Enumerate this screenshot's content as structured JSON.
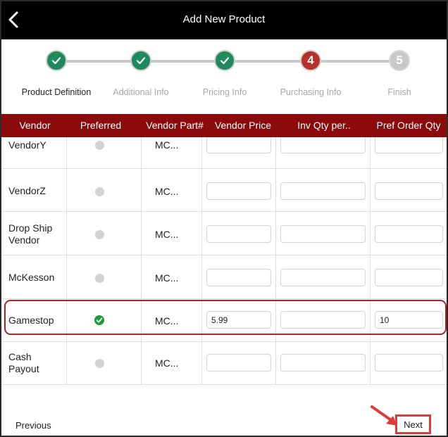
{
  "header": {
    "title": "Add New Product",
    "back_icon": "chevron-left-icon"
  },
  "stepper": {
    "steps": [
      {
        "label": "Product Definition",
        "state": "done",
        "marker": ""
      },
      {
        "label": "Additional Info",
        "state": "done",
        "marker": ""
      },
      {
        "label": "Pricing Info",
        "state": "done",
        "marker": ""
      },
      {
        "label": "Purchasing Info",
        "state": "active",
        "marker": "4"
      },
      {
        "label": "Finish",
        "state": "pending",
        "marker": "5"
      }
    ],
    "colors": {
      "done": "#1f8a5e",
      "active": "#b5312a",
      "pending": "#c8c8c8"
    }
  },
  "table": {
    "header_color": "#8b0a0c",
    "columns": [
      "Vendor",
      "Preferred",
      "Vendor Part#",
      "Vendor Price",
      "Inv Qty per..",
      "Pref Order Qty"
    ],
    "rows": [
      {
        "vendor": "VendorY",
        "preferred": false,
        "part": "MC...",
        "price": "",
        "inv_qty": "",
        "pref_qty": ""
      },
      {
        "vendor": "VendorZ",
        "preferred": false,
        "part": "MC...",
        "price": "",
        "inv_qty": "",
        "pref_qty": ""
      },
      {
        "vendor": "Drop Ship Vendor",
        "preferred": false,
        "part": "MC...",
        "price": "",
        "inv_qty": "",
        "pref_qty": ""
      },
      {
        "vendor": "McKesson",
        "preferred": false,
        "part": "MC...",
        "price": "",
        "inv_qty": "",
        "pref_qty": ""
      },
      {
        "vendor": "Gamestop",
        "preferred": true,
        "part": "MC...",
        "price": "5.99",
        "inv_qty": "",
        "pref_qty": "10"
      },
      {
        "vendor": "Cash Payout",
        "preferred": false,
        "part": "MC...",
        "price": "",
        "inv_qty": "",
        "pref_qty": ""
      }
    ]
  },
  "footer": {
    "previous_label": "Previous",
    "next_label": "Next"
  },
  "annotation": {
    "color": "#e03b3b",
    "arrow_icon": "arrow-pointer-icon"
  }
}
